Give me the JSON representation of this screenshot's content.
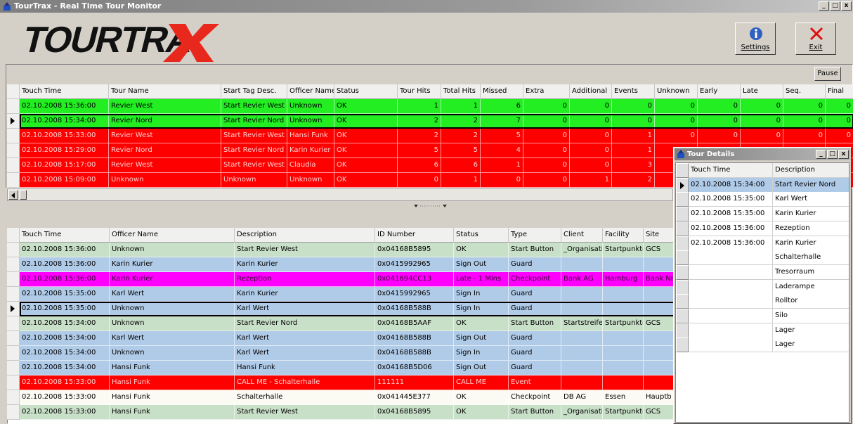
{
  "window": {
    "title": "TourTrax - Real Time Tour Monitor"
  },
  "toolbar": {
    "settings_label": "Settings",
    "exit_label": "Exit",
    "pause_label": "Pause",
    "logo_text": "TOURTRAX"
  },
  "tour_grid": {
    "columns": [
      "Touch Time",
      "Tour Name",
      "Start Tag Desc.",
      "Officer Name",
      "Status",
      "Tour Hits",
      "Total Hits",
      "Missed",
      "Extra",
      "Additional",
      "Events",
      "Unknown",
      "Early",
      "Late",
      "Seq.",
      "Final"
    ],
    "rows": [
      {
        "color": "green",
        "cells": [
          "02.10.2008 15:36:00",
          "Revier West",
          "Start Revier West",
          "Unknown",
          "OK",
          "1",
          "1",
          "6",
          "0",
          "0",
          "0",
          "0",
          "0",
          "0",
          "0",
          "0"
        ]
      },
      {
        "color": "green",
        "selected": true,
        "cells": [
          "02.10.2008 15:34:00",
          "Revier Nord",
          "Start Revier Nord",
          "Unknown",
          "OK",
          "2",
          "2",
          "7",
          "0",
          "0",
          "0",
          "0",
          "0",
          "0",
          "0",
          "0"
        ]
      },
      {
        "color": "red",
        "cells": [
          "02.10.2008 15:33:00",
          "Revier West",
          "Start Revier West",
          "Hansi Funk",
          "OK",
          "2",
          "2",
          "5",
          "0",
          "0",
          "1",
          "0",
          "0",
          "0",
          "0",
          "0"
        ]
      },
      {
        "color": "red",
        "cells": [
          "02.10.2008 15:29:00",
          "Revier Nord",
          "Start Revier Nord",
          "Karin Kurier",
          "OK",
          "5",
          "5",
          "4",
          "0",
          "0",
          "1",
          "",
          "",
          "",
          "",
          ""
        ]
      },
      {
        "color": "red",
        "cells": [
          "02.10.2008 15:17:00",
          "Revier West",
          "Start Revier West",
          "Claudia",
          "OK",
          "6",
          "6",
          "1",
          "0",
          "0",
          "3",
          "",
          "",
          "",
          "",
          ""
        ]
      },
      {
        "color": "red",
        "cells": [
          "02.10.2008 15:09:00",
          "Unknown",
          "Unknown",
          "Unknown",
          "OK",
          "0",
          "1",
          "0",
          "0",
          "1",
          "2",
          "",
          "",
          "",
          "",
          ""
        ]
      }
    ]
  },
  "event_grid": {
    "columns": [
      "Touch Time",
      "Officer Name",
      "Description",
      "ID Number",
      "Status",
      "Type",
      "Client",
      "Facility",
      "Site"
    ],
    "rows": [
      {
        "color": "ltgreen",
        "cells": [
          "02.10.2008 15:36:00",
          "Unknown",
          "Start Revier West",
          "0x04168B5895",
          "OK",
          "Start Button",
          "_Organisati",
          "Startpunkte",
          "GCS"
        ]
      },
      {
        "color": "blue",
        "cells": [
          "02.10.2008 15:36:00",
          "Karin Kurier",
          "Karin Kurier",
          "0x0415992965",
          "Sign Out",
          "Guard",
          "",
          "",
          ""
        ]
      },
      {
        "color": "magenta",
        "cells": [
          "02.10.2008 15:36:00",
          "Karin Kurier",
          "Rezeption",
          "0x041694CC13",
          "Late - 1 Mins",
          "Checkpoint",
          "Bank AG",
          "Hamburg",
          "Bank Nr"
        ]
      },
      {
        "color": "blue",
        "cells": [
          "02.10.2008 15:35:00",
          "Karl Wert",
          "Karin Kurier",
          "0x0415992965",
          "Sign In",
          "Guard",
          "",
          "",
          ""
        ]
      },
      {
        "color": "blue",
        "selected": true,
        "cells": [
          "02.10.2008 15:35:00",
          "Unknown",
          "Karl Wert",
          "0x04168B588B",
          "Sign In",
          "Guard",
          "",
          "",
          ""
        ]
      },
      {
        "color": "ltgreen",
        "cells": [
          "02.10.2008 15:34:00",
          "Unknown",
          "Start Revier Nord",
          "0x04168B5AAF",
          "OK",
          "Start Button",
          "Startstreife",
          "Startpunkte",
          "GCS"
        ]
      },
      {
        "color": "blue",
        "cells": [
          "02.10.2008 15:34:00",
          "Karl Wert",
          "Karl Wert",
          "0x04168B588B",
          "Sign Out",
          "Guard",
          "",
          "",
          ""
        ]
      },
      {
        "color": "blue",
        "cells": [
          "02.10.2008 15:34:00",
          "Unknown",
          "Karl Wert",
          "0x04168B588B",
          "Sign In",
          "Guard",
          "",
          "",
          ""
        ]
      },
      {
        "color": "blue",
        "cells": [
          "02.10.2008 15:34:00",
          "Hansi Funk",
          "Hansi Funk",
          "0x04168B5D06",
          "Sign Out",
          "Guard",
          "",
          "",
          ""
        ]
      },
      {
        "color": "red",
        "cells": [
          "02.10.2008 15:33:00",
          "Hansi Funk",
          "CALL ME - Schalterhalle",
          "111111",
          "CALL ME",
          "Event",
          "",
          "",
          ""
        ]
      },
      {
        "color": "cream",
        "cells": [
          "02.10.2008 15:33:00",
          "Hansi Funk",
          "Schalterhalle",
          "0x041445E377",
          "OK",
          "Checkpoint",
          "DB AG",
          "Essen",
          "Hauptb"
        ]
      },
      {
        "color": "ltgreen",
        "cells": [
          "02.10.2008 15:33:00",
          "Hansi Funk",
          "Start Revier West",
          "0x04168B5895",
          "OK",
          "Start Button",
          "_Organisati",
          "Startpunkte",
          "GCS"
        ]
      }
    ]
  },
  "tour_details": {
    "title": "Tour Details",
    "columns": [
      "Touch Time",
      "Description"
    ],
    "rows": [
      {
        "selected": true,
        "cells": [
          "02.10.2008 15:34:00",
          "Start Revier Nord"
        ]
      },
      {
        "cells": [
          "02.10.2008 15:35:00",
          "Karl Wert"
        ]
      },
      {
        "cells": [
          "02.10.2008 15:35:00",
          "Karin Kurier"
        ]
      },
      {
        "cells": [
          "02.10.2008 15:36:00",
          "Rezeption"
        ]
      },
      {
        "cells": [
          "02.10.2008 15:36:00",
          "Karin Kurier"
        ]
      },
      {
        "cells": [
          "",
          "Schalterhalle"
        ]
      },
      {
        "cells": [
          "",
          "Tresorraum"
        ]
      },
      {
        "cells": [
          "",
          "Laderampe"
        ]
      },
      {
        "cells": [
          "",
          "Rolltor"
        ]
      },
      {
        "cells": [
          "",
          "Silo"
        ]
      },
      {
        "cells": [
          "",
          "Lager"
        ]
      },
      {
        "cells": [
          "",
          "Lager"
        ]
      }
    ]
  },
  "colors": {
    "green": "#22ee22",
    "red": "#ff0000",
    "ltgreen": "#c8dfc8",
    "blue": "#b0cbe8",
    "magenta": "#ff00ff",
    "cream": "#fbfbf3"
  }
}
